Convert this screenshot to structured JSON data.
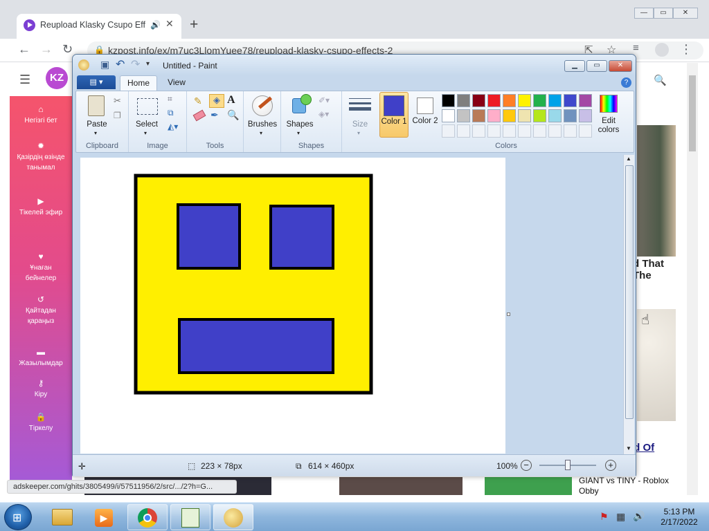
{
  "browser": {
    "tab_title": "Reupload Klasky Csupo Effe",
    "url": "kzpost.info/ex/m7uc3LlomYuee78/reupload-klasky-csupo-effects-2",
    "new_tab": "+",
    "tab_close": "✕"
  },
  "site": {
    "logo": "KZ",
    "sidebar": [
      {
        "icon": "home-icon",
        "glyph": "⌂",
        "label": "Негізгі бет"
      },
      {
        "icon": "fire-icon",
        "glyph": "✹",
        "label": "Қазірдің өзінде танымал"
      },
      {
        "icon": "live-icon",
        "glyph": "▶",
        "label": "Тікелей эфир"
      },
      {
        "icon": "heart-icon",
        "glyph": "♥",
        "label": "Ұнаған бейнелер"
      },
      {
        "icon": "history-icon",
        "glyph": "↺",
        "label": "Қайтадан қараңыз"
      },
      {
        "icon": "folder-icon",
        "glyph": "▬",
        "label": "Жазылымдар"
      },
      {
        "icon": "key-icon",
        "glyph": "⚷",
        "label": "Кіру"
      },
      {
        "icon": "lock-icon",
        "glyph": "🔒",
        "label": "Тіркелу"
      }
    ],
    "card1_text": "d That The",
    "card2_text": "nd Of",
    "status_url": "adskeeper.com/ghits/3805499/i/57511956/2/src/.../2?h=G...",
    "bottom_card_text": "GIANT vs TINY - Roblox Obby"
  },
  "paint": {
    "window_title": "Untitled - Paint",
    "tabs": {
      "home": "Home",
      "view": "View"
    },
    "groups": {
      "clipboard": "Clipboard",
      "image": "Image",
      "tools": "Tools",
      "shapes": "Shapes",
      "colors": "Colors"
    },
    "buttons": {
      "paste": "Paste",
      "select": "Select",
      "brushes": "Brushes",
      "shapes": "Shapes",
      "size": "Size",
      "color1": "Color 1",
      "color2": "Color 2",
      "edit_colors": "Edit colors"
    },
    "color1": "#4040c8",
    "color2": "#ffffff",
    "palette_row1": [
      "#000000",
      "#7f7f7f",
      "#880015",
      "#ed1c24",
      "#ff7f27",
      "#fff200",
      "#22b14c",
      "#00a2e8",
      "#3f48cc",
      "#a349a4"
    ],
    "palette_row2": [
      "#ffffff",
      "#c3c3c3",
      "#b97a57",
      "#ffaec9",
      "#ffc90e",
      "#efe4b0",
      "#b5e61d",
      "#99d9ea",
      "#7092be",
      "#c8bfe7"
    ],
    "status": {
      "selection_size": "223 × 78px",
      "canvas_size": "614 × 460px",
      "zoom": "100%"
    },
    "drawing": {
      "background": "#ffffff",
      "face_color": "#ffef00",
      "feature_color": "#4040c8",
      "outline_color": "#000000"
    }
  },
  "taskbar": {
    "time": "5:13 PM",
    "date": "2/17/2022"
  }
}
